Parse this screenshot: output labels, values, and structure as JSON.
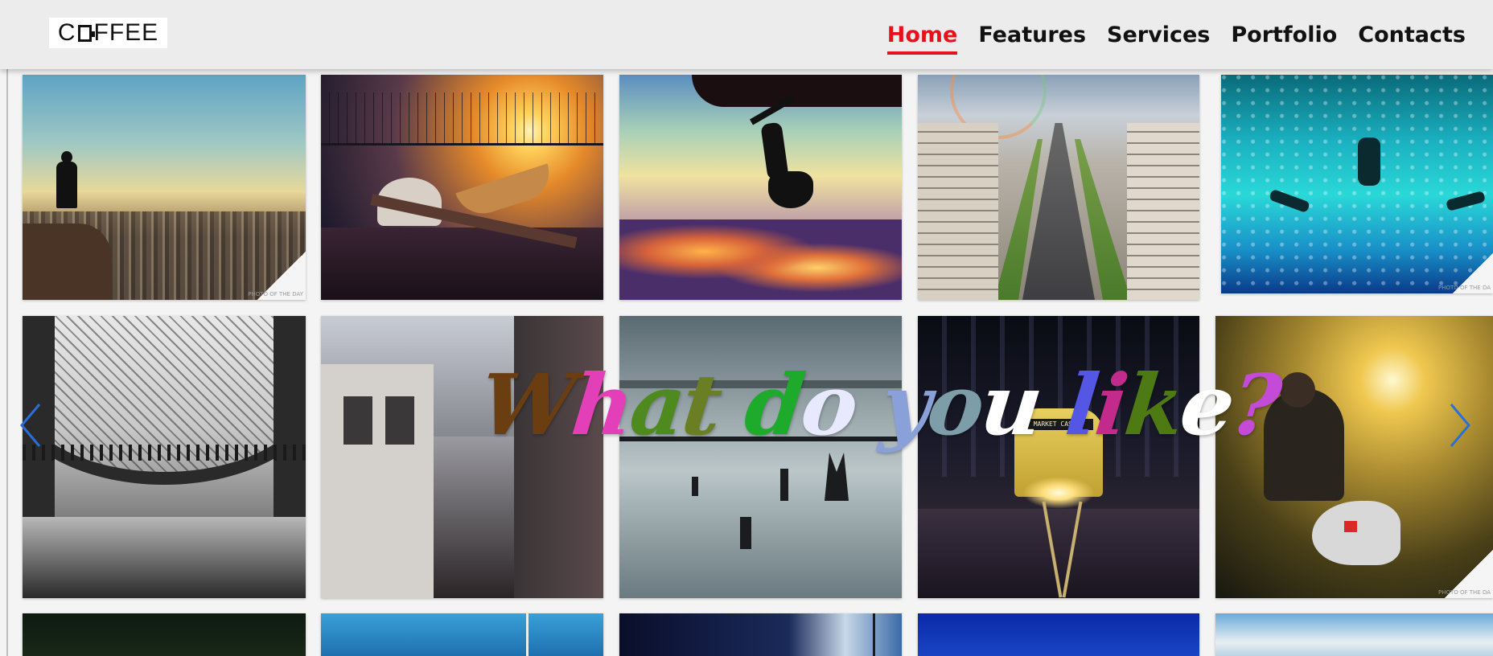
{
  "logo": {
    "text_before": "C",
    "text_after": "FFEE"
  },
  "nav": {
    "items": [
      {
        "label": "Home",
        "active": true
      },
      {
        "label": "Features",
        "active": false
      },
      {
        "label": "Services",
        "active": false
      },
      {
        "label": "Portfolio",
        "active": false
      },
      {
        "label": "Contacts",
        "active": false
      }
    ]
  },
  "hero": {
    "headline": "What do you like?",
    "headline_colors": [
      "#6b3e12",
      "#e23fb8",
      "#4f8a1e",
      "#6a7f24",
      "#1eaa2a",
      "#e8e8ff",
      "#8aa0d8",
      "#7d9ea8",
      "#ffffff",
      "#5457e4",
      "#c22a8c",
      "#4e7a14",
      "#ffffff",
      "#c44ad8",
      "#2a3a4a",
      "#e83aa8",
      "#6aa838",
      "#b8a0c8"
    ]
  },
  "carousel": {
    "prev_icon": "chevron-left-icon",
    "next_icon": "chevron-right-icon",
    "accent_color": "#2a6fd8"
  },
  "photos": [
    {
      "name": "photo-man-overlooking-city",
      "watermark": "PHOTO OF THE DAY"
    },
    {
      "name": "photo-bridge-boat-sunset"
    },
    {
      "name": "photo-climber-silhouette"
    },
    {
      "name": "photo-paris-avenue-rainbow"
    },
    {
      "name": "photo-underwater-swimmers",
      "watermark": "PHOTO OF THE DA"
    },
    {
      "name": "photo-eiffel-tower-reflection"
    },
    {
      "name": "photo-narrow-street-bw"
    },
    {
      "name": "photo-lake-stumps"
    },
    {
      "name": "photo-tram-night-street",
      "tram_sign": "MARKET CASTRO"
    },
    {
      "name": "photo-surfer-wave",
      "watermark": "PHOTO OF THE DA"
    },
    {
      "name": "photo-row3-1"
    },
    {
      "name": "photo-row3-2"
    },
    {
      "name": "photo-row3-3"
    },
    {
      "name": "photo-row3-4"
    },
    {
      "name": "photo-row3-5"
    }
  ]
}
